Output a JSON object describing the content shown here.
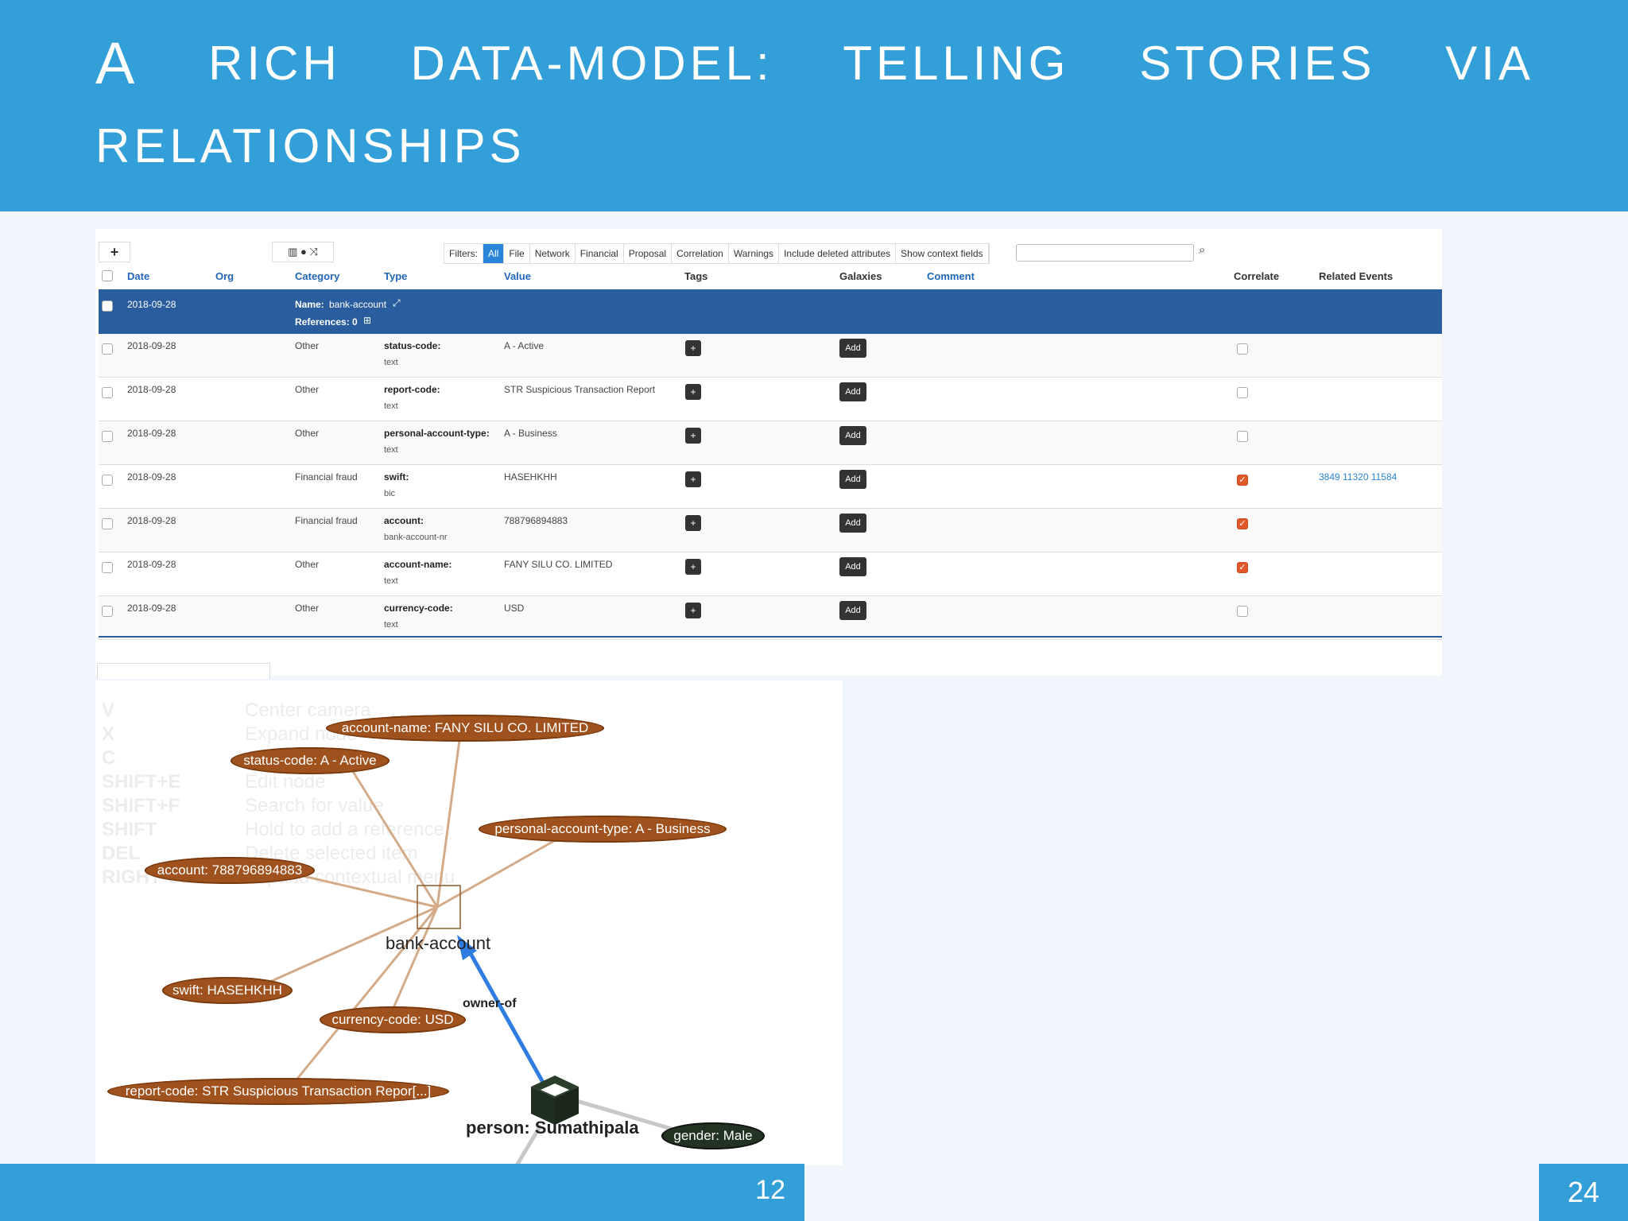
{
  "slide": {
    "title_words_line1": [
      "A",
      "RICH",
      "DATA-MODEL:",
      "TELLING",
      "STORIES",
      "VIA"
    ],
    "title_line2": "RELATIONSHIPS",
    "footer_number": "12",
    "page_number": "24"
  },
  "toolbar": {
    "add_icon": "plus-icon",
    "filters_label": "Filters:",
    "filters": [
      "All",
      "File",
      "Network",
      "Financial",
      "Proposal",
      "Correlation",
      "Warnings",
      "Include deleted attributes",
      "Show context fields"
    ],
    "active_filter": "All",
    "search_value": ""
  },
  "table": {
    "headers": {
      "date": "Date",
      "org": "Org",
      "category": "Category",
      "type": "Type",
      "value": "Value",
      "tags": "Tags",
      "galaxies": "Galaxies",
      "comment": "Comment",
      "correlate": "Correlate",
      "related": "Related Events"
    },
    "object": {
      "date": "2018-09-28",
      "name_label": "Name:",
      "name": "bank-account",
      "refs": "References: 0"
    },
    "rows": [
      {
        "date": "2018-09-28",
        "category": "Other",
        "type": "status-code:",
        "subtype": "text",
        "value": "A - Active",
        "correlate": false,
        "related": ""
      },
      {
        "date": "2018-09-28",
        "category": "Other",
        "type": "report-code:",
        "subtype": "text",
        "value": "STR Suspicious Transaction Report",
        "correlate": false,
        "related": ""
      },
      {
        "date": "2018-09-28",
        "category": "Other",
        "type": "personal-account-type:",
        "subtype": "text",
        "value": "A - Business",
        "correlate": false,
        "related": ""
      },
      {
        "date": "2018-09-28",
        "category": "Financial fraud",
        "type": "swift:",
        "subtype": "bic",
        "value": "HASEHKHH",
        "correlate": true,
        "related": "3849 11320 11584"
      },
      {
        "date": "2018-09-28",
        "category": "Financial fraud",
        "type": "account:",
        "subtype": "bank-account-nr",
        "value": "788796894883",
        "correlate": true,
        "related": ""
      },
      {
        "date": "2018-09-28",
        "category": "Other",
        "type": "account-name:",
        "subtype": "text",
        "value": "FANY SILU CO. LIMITED",
        "correlate": true,
        "related": ""
      },
      {
        "date": "2018-09-28",
        "category": "Other",
        "type": "currency-code:",
        "subtype": "text",
        "value": "USD",
        "correlate": false,
        "related": ""
      }
    ],
    "tag_button": "+",
    "add_button": "Add"
  },
  "graph": {
    "ghost_keys": [
      "V",
      "X",
      "C",
      "SHIFT+E",
      "SHIFT+F",
      "SHIFT",
      "DEL",
      "RIGHT-CLICK"
    ],
    "ghost_text": [
      "Center camera",
      "Expand node",
      "",
      "Edit node",
      "Search for value",
      "Hold to add a reference",
      "Delete selected item",
      "Expand contextual menu"
    ],
    "center_node": "bank-account",
    "edge_label": "owner-of",
    "person_node": "person: Sumathipala",
    "attr_nodes": [
      "account-name: FANY SILU CO. LIMITED",
      "status-code: A - Active",
      "personal-account-type: A - Business",
      "account: 788796894883",
      "swift: HASEHKHH",
      "currency-code: USD",
      "report-code: STR Suspicious Transaction Repor[...]"
    ],
    "gender_node": "gender: Male"
  }
}
